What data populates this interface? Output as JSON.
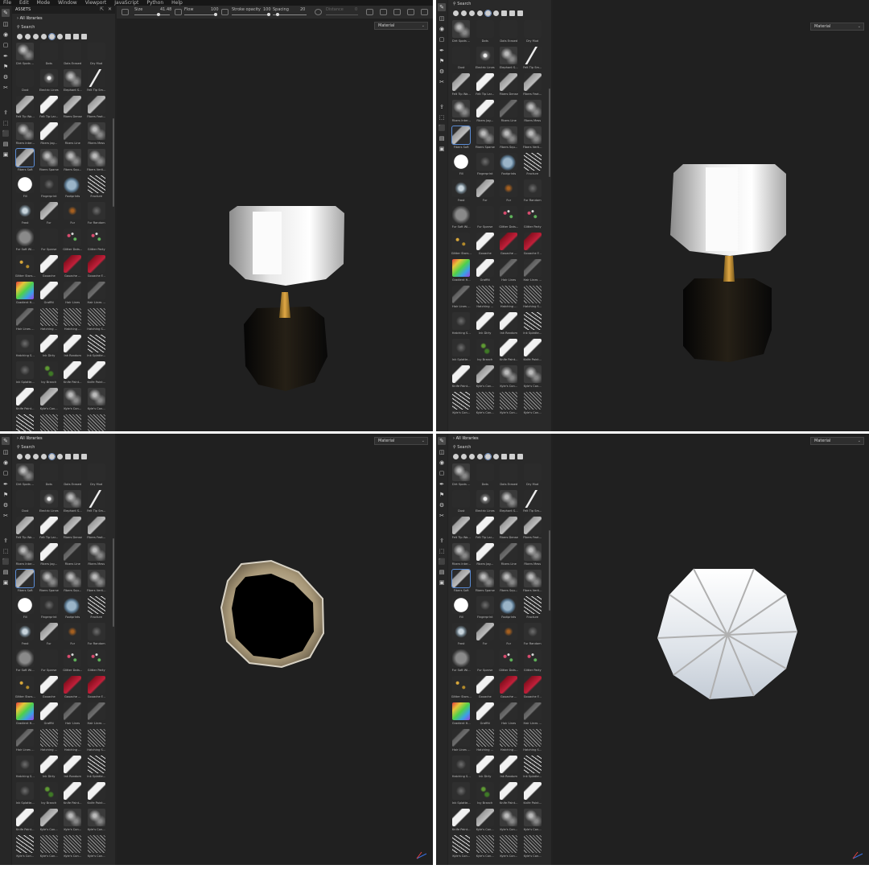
{
  "colors": {
    "panel_bg": "#212121",
    "selection_accent": "#5b8dd6"
  },
  "menu": [
    "File",
    "Edit",
    "Mode",
    "Window",
    "Viewport",
    "JavaScript",
    "Python",
    "Help"
  ],
  "tool_properties": {
    "size_label": "Size",
    "size_value": "41.48",
    "flow_label": "Flow",
    "flow_value": "100",
    "stroke_opacity_label": "Stroke opacity",
    "stroke_opacity_value": "100",
    "spacing_label": "Spacing",
    "spacing_value": "20",
    "distance_label": "Distance",
    "distance_value": "0"
  },
  "assets": {
    "title": "ASSETS",
    "library": "All libraries",
    "search_placeholder": "Search"
  },
  "viewport": {
    "material_select": "Material"
  },
  "brushes": [
    {
      "label": "Dirt Spots ...",
      "thumb": "dust"
    },
    {
      "label": "Dots",
      "thumb": "none"
    },
    {
      "label": "Dots Erased",
      "thumb": "none"
    },
    {
      "label": "Dry Mud",
      "thumb": "none"
    },
    {
      "label": "Dust",
      "thumb": "none"
    },
    {
      "label": "Electric Lines",
      "thumb": "splat"
    },
    {
      "label": "Elephant S...",
      "thumb": "dust"
    },
    {
      "label": "Felt Tip Sm...",
      "thumb": "wave"
    },
    {
      "label": "Felt Tip Wa...",
      "thumb": "stroke-grey"
    },
    {
      "label": "Felt Tip Lar...",
      "thumb": "stroke"
    },
    {
      "label": "Fibers Dense",
      "thumb": "stroke-grey"
    },
    {
      "label": "Fibers Feat...",
      "thumb": "stroke-grey"
    },
    {
      "label": "Fibers Inter...",
      "thumb": "dust"
    },
    {
      "label": "Fibers Jag...",
      "thumb": "stroke"
    },
    {
      "label": "Fibers Line",
      "thumb": "stroke-faint"
    },
    {
      "label": "Fibers Mess",
      "thumb": "dust"
    },
    {
      "label": "Fibers Soft",
      "thumb": "stroke-grey",
      "selected": true
    },
    {
      "label": "Fibers Sparse",
      "thumb": "dust"
    },
    {
      "label": "Fibers Squ...",
      "thumb": "dust"
    },
    {
      "label": "Fibers Verti...",
      "thumb": "dust"
    },
    {
      "label": "Fill",
      "thumb": "fill"
    },
    {
      "label": "Fingerprint",
      "thumb": "dust-faint"
    },
    {
      "label": "Footprints",
      "thumb": "blue"
    },
    {
      "label": "Fracture",
      "thumb": "cracks"
    },
    {
      "label": "Frost",
      "thumb": "frost"
    },
    {
      "label": "Fur",
      "thumb": "stroke-grey"
    },
    {
      "label": "Fur",
      "thumb": "orange"
    },
    {
      "label": "Fur Random",
      "thumb": "dust-faint"
    },
    {
      "label": "Fur Soft Wi...",
      "thumb": "soft"
    },
    {
      "label": "Fur Sparse",
      "thumb": "none"
    },
    {
      "label": "Glitter Dots...",
      "thumb": "glitter"
    },
    {
      "label": "Glitter Party",
      "thumb": "glitter"
    },
    {
      "label": "Glitter Stars...",
      "thumb": "gold"
    },
    {
      "label": "Gouache",
      "thumb": "stroke"
    },
    {
      "label": "Gouache ...",
      "thumb": "red"
    },
    {
      "label": "Gouache F...",
      "thumb": "red"
    },
    {
      "label": "Gradient H...",
      "thumb": "rainbow"
    },
    {
      "label": "Graffiti",
      "thumb": "stroke"
    },
    {
      "label": "Hair Lines",
      "thumb": "stroke-faint"
    },
    {
      "label": "Hair Lines ...",
      "thumb": "stroke-faint"
    },
    {
      "label": "Hair Lines ...",
      "thumb": "stroke-faint"
    },
    {
      "label": "Hatching ...",
      "thumb": "hatch"
    },
    {
      "label": "Hatching ...",
      "thumb": "hatch"
    },
    {
      "label": "Hatching S...",
      "thumb": "hatch"
    },
    {
      "label": "Hatching S...",
      "thumb": "dust-faint"
    },
    {
      "label": "Ink Dirty",
      "thumb": "stroke"
    },
    {
      "label": "Ink Random",
      "thumb": "stroke"
    },
    {
      "label": "Ink Splatte...",
      "thumb": "cracks"
    },
    {
      "label": "Ink Splatte...",
      "thumb": "dust-faint"
    },
    {
      "label": "Ivy Branch",
      "thumb": "ivy"
    },
    {
      "label": "Knife Paint...",
      "thumb": "stroke"
    },
    {
      "label": "Knife Paint...",
      "thumb": "stroke"
    },
    {
      "label": "Knife Paint...",
      "thumb": "stroke"
    },
    {
      "label": "Kyle's Con...",
      "thumb": "stroke-grey"
    },
    {
      "label": "Kyle's Con...",
      "thumb": "dust"
    },
    {
      "label": "Kyle's Con...",
      "thumb": "dust"
    },
    {
      "label": "Kyle's Con...",
      "thumb": "cracks"
    },
    {
      "label": "Kyle's Con...",
      "thumb": "hatch"
    },
    {
      "label": "Kyle's Con...",
      "thumb": "hatch"
    },
    {
      "label": "Kyle's Con...",
      "thumb": "hatch"
    }
  ],
  "views": [
    {
      "id": "p1",
      "object": "front",
      "show_menu": true,
      "grid_start": 0
    },
    {
      "id": "p2",
      "object": "front-alt",
      "show_menu": false,
      "grid_start": 0
    },
    {
      "id": "p3",
      "object": "top",
      "show_menu": false,
      "grid_start": 0
    },
    {
      "id": "p4",
      "object": "bottom",
      "show_menu": false,
      "grid_start": 0
    }
  ]
}
